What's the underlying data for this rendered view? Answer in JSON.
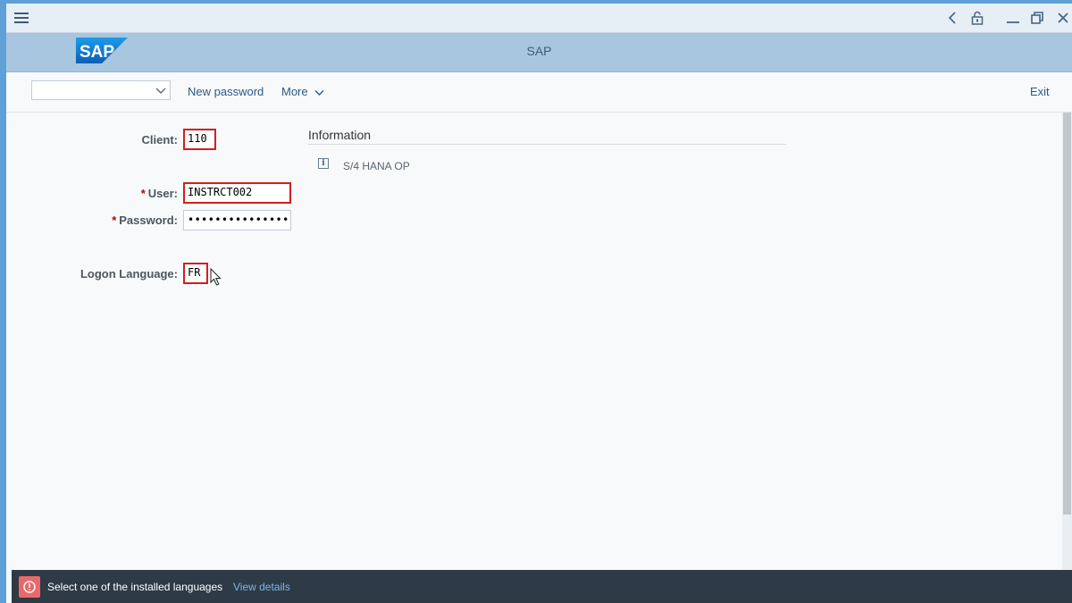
{
  "window": {
    "menu_icon": "hamburger-icon",
    "controls": [
      "back-icon",
      "lock-icon",
      "minimize-icon",
      "restore-icon",
      "close-icon"
    ]
  },
  "header": {
    "logo_text": "SAP",
    "title": "SAP"
  },
  "toolbar": {
    "transaction_value": "",
    "new_password_label": "New password",
    "more_label": "More",
    "exit_label": "Exit"
  },
  "form": {
    "client_label": "Client:",
    "client_value": "110",
    "user_label": "User:",
    "user_value": "INSTRCT002",
    "password_label": "Password:",
    "password_value": "•••••••••••••••",
    "language_label": "Logon Language:",
    "language_value": "FR",
    "required_marker": "*"
  },
  "info": {
    "title": "Information",
    "text": "S/4 HANA OP",
    "icon": "info-icon"
  },
  "status": {
    "message": "Select one of the installed languages",
    "link": "View details",
    "type": "error"
  },
  "colors": {
    "header_bg": "#a8c6e0",
    "logo_blue": "#0a74c4",
    "error_red": "#d21f1f",
    "status_bg": "#2e3a45",
    "link_blue": "#2b5a87"
  }
}
